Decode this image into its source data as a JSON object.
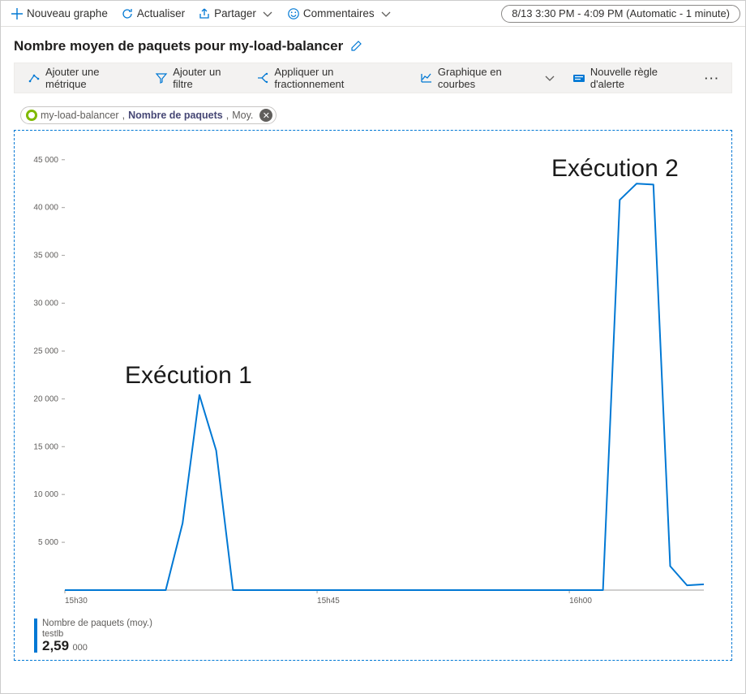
{
  "cmdbar": {
    "new_chart": "Nouveau graphe",
    "refresh": "Actualiser",
    "share": "Partager",
    "feedback": "Commentaires",
    "time_range": "8/13 3:30 PM - 4:09 PM (Automatic - 1 minute)"
  },
  "title": "Nombre moyen de paquets pour my-load-balancer",
  "toolbar": {
    "add_metric": "Ajouter une métrique",
    "add_filter": "Ajouter un filtre",
    "apply_splitting": "Appliquer un fractionnement",
    "chart_type": "Graphique en courbes",
    "new_alert": "Nouvelle règle d'alerte"
  },
  "metric_pill": {
    "resource": "my-load-balancer",
    "metric": "Nombre de paquets",
    "aggregation": "Moy."
  },
  "annotations": {
    "run1": "Exécution 1",
    "run2": "Exécution 2"
  },
  "legend": {
    "name": "Nombre de paquets (moy.)",
    "sub": "testlb",
    "value": "2,59",
    "unit": "000"
  },
  "chart_data": {
    "type": "line",
    "title": "Nombre moyen de paquets pour my-load-balancer",
    "xlabel": "",
    "ylabel": "",
    "ylim": [
      0,
      46000
    ],
    "x_ticks": [
      "15h30",
      "15h45",
      "16h00"
    ],
    "y_ticks": [
      5000,
      10000,
      15000,
      20000,
      25000,
      30000,
      35000,
      40000,
      45000
    ],
    "y_tick_labels": [
      "5 000",
      "10 000",
      "15 000",
      "20 000",
      "25 000",
      "30 000",
      "35 000",
      "40 000",
      "45 000"
    ],
    "series": [
      {
        "name": "Nombre de paquets (moy.)",
        "color": "#0078d4",
        "points": [
          {
            "x": "15:30",
            "y": 0
          },
          {
            "x": "15:31",
            "y": 0
          },
          {
            "x": "15:32",
            "y": 0
          },
          {
            "x": "15:33",
            "y": 0
          },
          {
            "x": "15:34",
            "y": 0
          },
          {
            "x": "15:35",
            "y": 0
          },
          {
            "x": "15:36",
            "y": 0
          },
          {
            "x": "15:37",
            "y": 7000
          },
          {
            "x": "15:38",
            "y": 20400
          },
          {
            "x": "15:39",
            "y": 14600
          },
          {
            "x": "15:40",
            "y": 0
          },
          {
            "x": "15:41",
            "y": 0
          },
          {
            "x": "15:42",
            "y": 0
          },
          {
            "x": "15:43",
            "y": 0
          },
          {
            "x": "15:44",
            "y": 0
          },
          {
            "x": "15:45",
            "y": 0
          },
          {
            "x": "15:46",
            "y": 0
          },
          {
            "x": "15:47",
            "y": 0
          },
          {
            "x": "15:48",
            "y": 0
          },
          {
            "x": "15:49",
            "y": 0
          },
          {
            "x": "15:50",
            "y": 0
          },
          {
            "x": "15:51",
            "y": 0
          },
          {
            "x": "15:52",
            "y": 0
          },
          {
            "x": "15:53",
            "y": 0
          },
          {
            "x": "15:54",
            "y": 0
          },
          {
            "x": "15:55",
            "y": 0
          },
          {
            "x": "15:56",
            "y": 0
          },
          {
            "x": "15:57",
            "y": 0
          },
          {
            "x": "15:58",
            "y": 0
          },
          {
            "x": "15:59",
            "y": 0
          },
          {
            "x": "16:00",
            "y": 0
          },
          {
            "x": "16:01",
            "y": 0
          },
          {
            "x": "16:02",
            "y": 0
          },
          {
            "x": "16:03",
            "y": 40800
          },
          {
            "x": "16:04",
            "y": 42500
          },
          {
            "x": "16:05",
            "y": 42400
          },
          {
            "x": "16:06",
            "y": 2500
          },
          {
            "x": "16:07",
            "y": 500
          },
          {
            "x": "16:08",
            "y": 600
          }
        ],
        "aggregate_value_thousands": 2.59
      }
    ]
  }
}
